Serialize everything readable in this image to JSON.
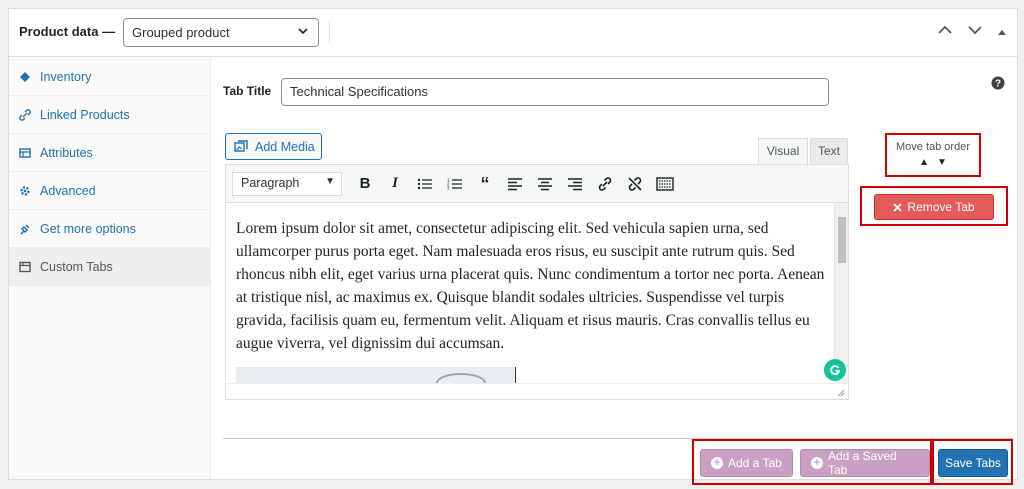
{
  "header": {
    "title": "Product data —",
    "product_type": "Grouped product"
  },
  "sidebar": {
    "items": [
      {
        "label": "Inventory",
        "icon": "diamond-icon"
      },
      {
        "label": "Linked Products",
        "icon": "link-icon"
      },
      {
        "label": "Attributes",
        "icon": "table-icon"
      },
      {
        "label": "Advanced",
        "icon": "gear-icon"
      },
      {
        "label": "Get more options",
        "icon": "plugin-icon"
      },
      {
        "label": "Custom Tabs",
        "icon": "tabs-icon"
      }
    ]
  },
  "main": {
    "tab_title_label": "Tab Title",
    "tab_title_value": "Technical Specifications",
    "add_media_label": "Add Media",
    "editor_tabs": {
      "visual": "Visual",
      "text": "Text"
    },
    "format_select": "Paragraph",
    "content": "Lorem ipsum dolor sit amet, consectetur adipiscing elit. Sed vehicula sapien urna, sed ullamcorper purus porta eget. Nam malesuada eros risus, eu suscipit ante rutrum quis. Sed rhoncus nibh elit, eget varius urna placerat quis. Nunc condimentum a tortor nec porta. Aenean at tristique nisl, ac maximus ex. Quisque blandit sodales ultricies. Suspendisse vel turpis gravida, facilisis quam eu, fermentum velit. Aliquam et risus mauris. Cras convallis tellus eu augue viverra, vel dignissim dui accumsan.",
    "move_tab_order_label": "Move tab order",
    "remove_tab_label": "Remove Tab",
    "add_tab_label": "Add a Tab",
    "add_saved_tab_label": "Add a Saved Tab",
    "save_tabs_label": "Save Tabs"
  },
  "colors": {
    "link": "#2271b1",
    "remove": "#e35b5b",
    "purple_button": "#c9a0c3",
    "primary": "#2271b1",
    "highlight_box": "#cc0000"
  }
}
